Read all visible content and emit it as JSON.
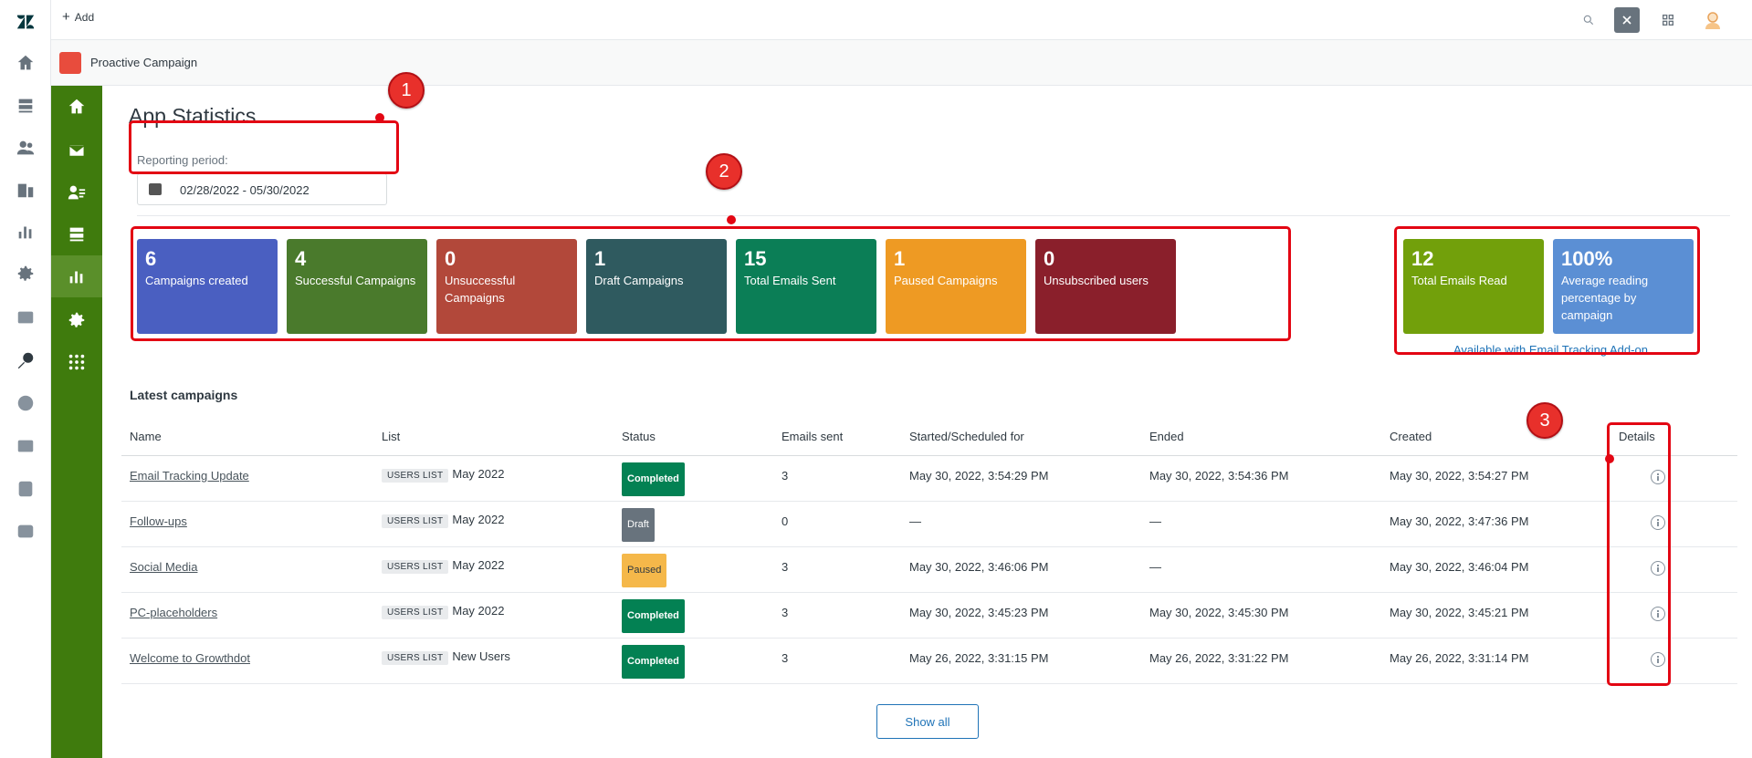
{
  "topbar": {
    "add_label": "Add"
  },
  "app": {
    "title": "Proactive Campaign"
  },
  "page": {
    "title": "App Statistics"
  },
  "period": {
    "label": "Reporting period:",
    "value": "02/28/2022 - 05/30/2022"
  },
  "stats": [
    {
      "value": "6",
      "label": "Campaigns created",
      "color": "#4a5fc1"
    },
    {
      "value": "4",
      "label": "Successful Campaigns",
      "color": "#4a7a2c"
    },
    {
      "value": "0",
      "label": "Unsuccessful Campaigns",
      "color": "#b2483a"
    },
    {
      "value": "1",
      "label": "Draft Campaigns",
      "color": "#2f5a5f"
    },
    {
      "value": "15",
      "label": "Total Emails Sent",
      "color": "#0b7e56"
    },
    {
      "value": "1",
      "label": "Paused Campaigns",
      "color": "#ee9a23"
    },
    {
      "value": "0",
      "label": "Unsubscribed users",
      "color": "#8a1f2b"
    }
  ],
  "tracking": [
    {
      "value": "12",
      "label": "Total Emails Read",
      "color": "#72a00b"
    },
    {
      "value": "100%",
      "label": "Average reading percentage by campaign",
      "color": "#5b8fd4"
    }
  ],
  "addon_note": "Available with Email Tracking Add-on",
  "latest": {
    "title": "Latest campaigns",
    "columns": [
      "Name",
      "List",
      "Status",
      "Emails sent",
      "Started/Scheduled for",
      "Ended",
      "Created",
      "Details"
    ],
    "rows": [
      {
        "name": "Email Tracking Update",
        "tag": "USERS LIST",
        "list": "May 2022",
        "status": "Completed",
        "sent": "3",
        "started": "May 30, 2022, 3:54:29 PM",
        "ended": "May 30, 2022, 3:54:36 PM",
        "created": "May 30, 2022, 3:54:27 PM"
      },
      {
        "name": "Follow-ups",
        "tag": "USERS LIST",
        "list": "May 2022",
        "status": "Draft",
        "sent": "0",
        "started": "—",
        "ended": "—",
        "created": "May 30, 2022, 3:47:36 PM"
      },
      {
        "name": "Social Media",
        "tag": "USERS LIST",
        "list": "May 2022",
        "status": "Paused",
        "sent": "3",
        "started": "May 30, 2022, 3:46:06 PM",
        "ended": "—",
        "created": "May 30, 2022, 3:46:04 PM"
      },
      {
        "name": "PC-placeholders",
        "tag": "USERS LIST",
        "list": "May 2022",
        "status": "Completed",
        "sent": "3",
        "started": "May 30, 2022, 3:45:23 PM",
        "ended": "May 30, 2022, 3:45:30 PM",
        "created": "May 30, 2022, 3:45:21 PM"
      },
      {
        "name": "Welcome to Growthdot",
        "tag": "USERS LIST",
        "list": "New Users",
        "status": "Completed",
        "sent": "3",
        "started": "May 26, 2022, 3:31:15 PM",
        "ended": "May 26, 2022, 3:31:22 PM",
        "created": "May 26, 2022, 3:31:14 PM"
      }
    ],
    "show_all": "Show all"
  },
  "annotations": [
    "1",
    "2",
    "3"
  ]
}
